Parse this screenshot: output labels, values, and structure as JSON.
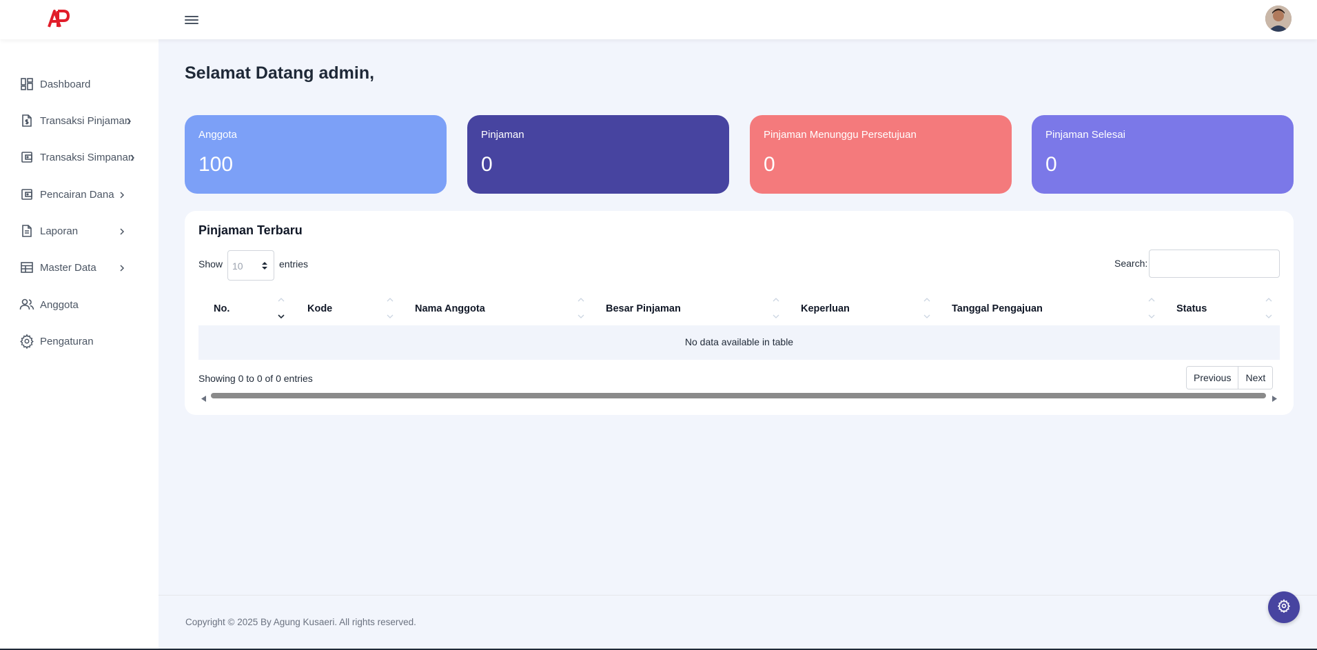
{
  "header": {
    "logo_text": "AP"
  },
  "sidebar": {
    "items": [
      {
        "label": "Dashboard",
        "icon": "dashboard-icon",
        "has_submenu": false
      },
      {
        "label": "Transaksi Pinjaman",
        "icon": "document-dollar-icon",
        "has_submenu": true
      },
      {
        "label": "Transaksi Simpanan",
        "icon": "wallet-icon",
        "has_submenu": true
      },
      {
        "label": "Pencairan Dana",
        "icon": "wallet-icon",
        "has_submenu": true
      },
      {
        "label": "Laporan",
        "icon": "document-icon",
        "has_submenu": true
      },
      {
        "label": "Master Data",
        "icon": "table-icon",
        "has_submenu": true
      },
      {
        "label": "Anggota",
        "icon": "users-icon",
        "has_submenu": false
      },
      {
        "label": "Pengaturan",
        "icon": "gear-icon",
        "has_submenu": false
      }
    ]
  },
  "main": {
    "title": "Selamat Datang admin,",
    "cards": [
      {
        "label": "Anggota",
        "value": "100",
        "color": "#7ca0f7"
      },
      {
        "label": "Pinjaman",
        "value": "0",
        "color": "#4744a0"
      },
      {
        "label": "Pinjaman Menunggu Persetujuan",
        "value": "0",
        "color": "#f47a7c"
      },
      {
        "label": "Pinjaman Selesai",
        "value": "0",
        "color": "#7b78e8"
      }
    ],
    "table": {
      "title": "Pinjaman Terbaru",
      "show_label": "Show",
      "length_value": "10",
      "entries_label": "entries",
      "search_label": "Search:",
      "search_value": "",
      "columns": [
        "No.",
        "Kode",
        "Nama Anggota",
        "Besar Pinjaman",
        "Keperluan",
        "Tanggal Pengajuan",
        "Status"
      ],
      "empty_text": "No data available in table",
      "info": "Showing 0 to 0 of 0 entries",
      "pager": {
        "previous": "Previous",
        "next": "Next"
      }
    }
  },
  "footer": {
    "copyright": "Copyright © 2025 By Agung Kusaeri. All rights reserved."
  },
  "colors": {
    "background": "#f2f5fc",
    "accent": "#4744a0",
    "logo": "#e11d2a"
  }
}
